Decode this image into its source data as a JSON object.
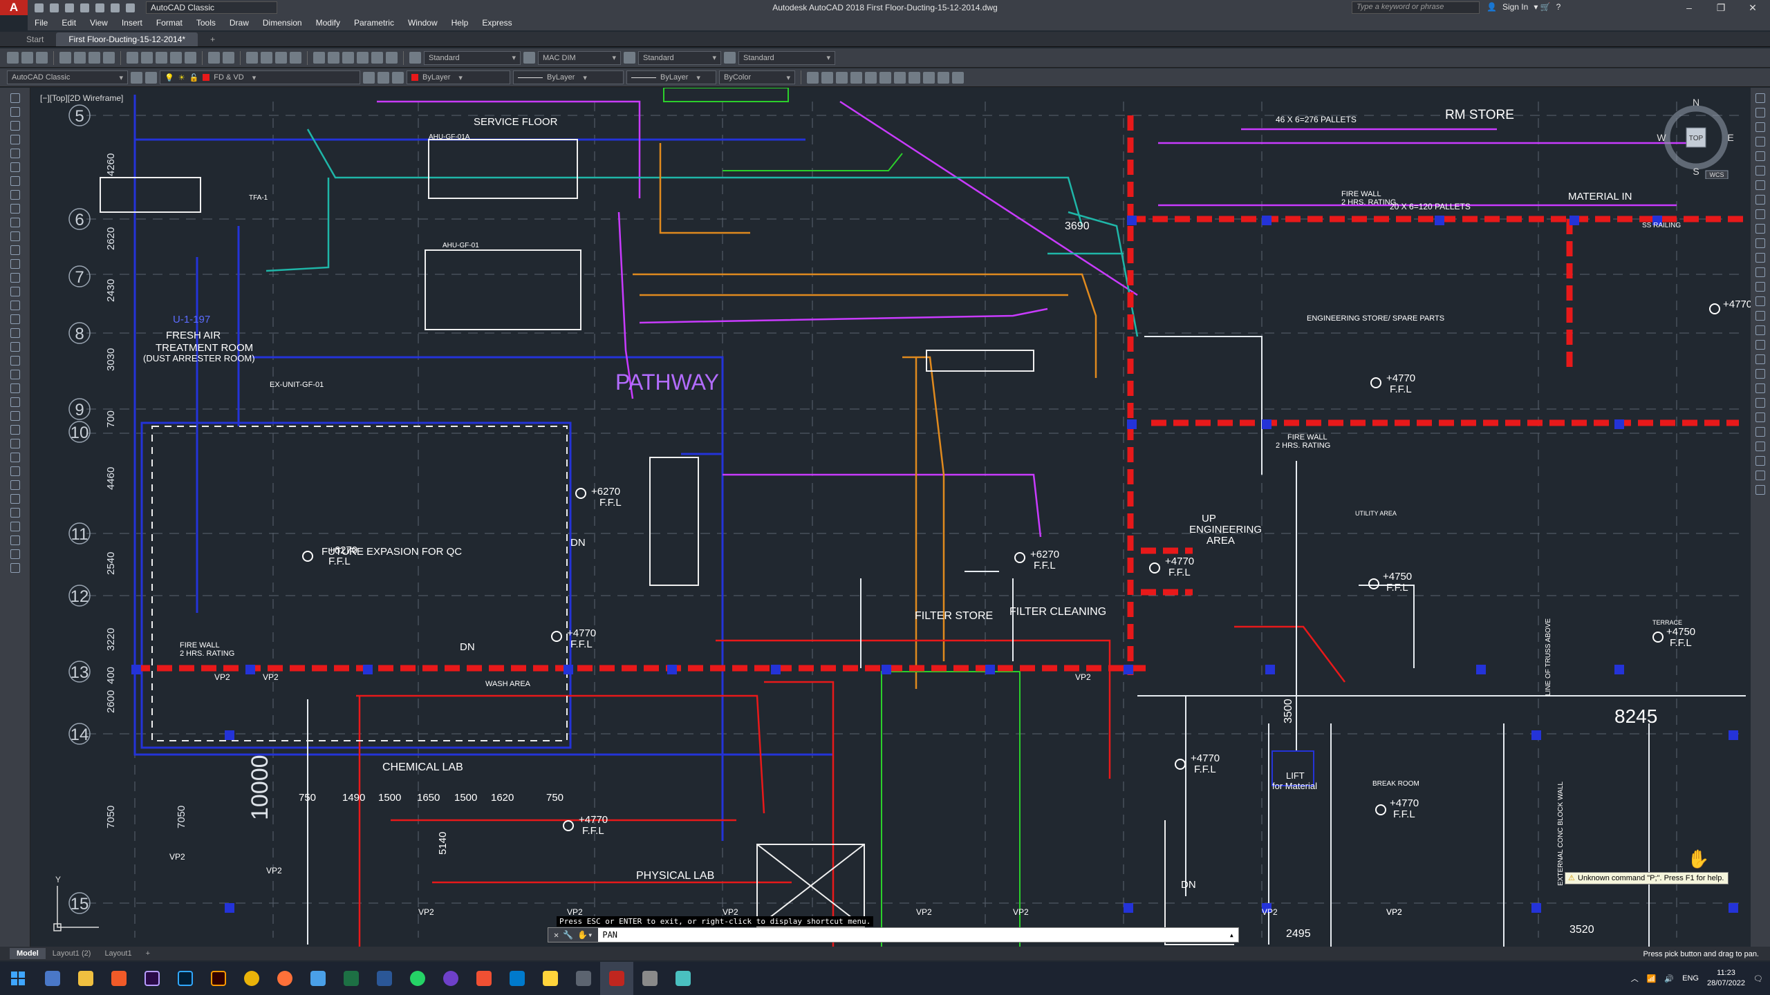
{
  "titlebar": {
    "logo": "A",
    "workspace": "AutoCAD Classic",
    "title": "Autodesk AutoCAD 2018    First Floor-Ducting-15-12-2014.dwg",
    "search_placeholder": "Type a keyword or phrase",
    "signin": "Sign In"
  },
  "menu": [
    "File",
    "Edit",
    "View",
    "Insert",
    "Format",
    "Tools",
    "Draw",
    "Dimension",
    "Modify",
    "Parametric",
    "Window",
    "Help",
    "Express"
  ],
  "tabs": [
    "Start",
    "First Floor-Ducting-15-12-2014*"
  ],
  "toolbar1": {
    "text_style": "Standard",
    "dim_style": "MAC DIM",
    "table_style": "Standard",
    "mleader_style": "Standard"
  },
  "toolbar2": {
    "workspace": "AutoCAD Classic",
    "layer": "FD & VD",
    "color": "ByLayer",
    "linetype": "ByLayer",
    "lineweight": "ByLayer",
    "plotstyle": "ByColor"
  },
  "viewport_label": "[−][Top][2D Wireframe]",
  "viewcube": {
    "n": "N",
    "s": "S",
    "e": "E",
    "w": "W",
    "top": "TOP",
    "wcs": "WCS"
  },
  "drawing": {
    "grid_labels": [
      "5",
      "6",
      "7",
      "8",
      "9",
      "10",
      "11",
      "12",
      "13",
      "14",
      "15"
    ],
    "dims_left": [
      "4260",
      "2620",
      "2430",
      "3030",
      "700",
      "4460",
      "2540",
      "3220",
      "400",
      "2600",
      "7050",
      "7050",
      "10000"
    ],
    "rooms": {
      "service_floor": "SERVICE FLOOR",
      "fresh_air": "FRESH AIR",
      "treatment_room": "TREATMENT ROOM",
      "dust": "(DUST ARRESTER ROOM)",
      "u197": "U-1-197",
      "pathway": "PATHWAY",
      "future": "FUTURE EXPASION FOR QC",
      "rm_store": "RM STORE",
      "pallets1": "46 X 6=276 PALLETS",
      "pallets2": "20 X 6=120 PALLETS",
      "material_in": "MATERIAL IN",
      "fire_wall": "FIRE WALL",
      "fire_rating": "2 HRS. RATING",
      "eng_store": "ENGINEERING STORE/ SPARE PARTS",
      "filter_store": "FILTER STORE",
      "filter_cleaning": "FILTER CLEANING",
      "up": "UP",
      "eng_area1": "ENGINEERING",
      "eng_area2": "AREA",
      "chemical_lab": "CHEMICAL LAB",
      "physical_lab": "PHYSICAL LAB",
      "wash_area": "WASH AREA",
      "lift1": "LIFT",
      "lift2": "for Material",
      "break_room": "BREAK ROOM",
      "utility": "UTILITY AREA",
      "terrace": "TERRACE",
      "dn": "DN",
      "ex_unit": "EX-UNIT-GF-01",
      "ahu1": "AHU-GF-01A",
      "ahu2": "AHU-GF-01",
      "tfa": "TFA-1",
      "line_truss": "LINE OF TRUSS ABOVE",
      "ext_wall": "EXTERNAL CONC BLOCK WALL",
      "ss_railing": "SS RAILING",
      "vp2": "VP2"
    },
    "levels": {
      "ffl": "F.F.L",
      "l6270": "+6270",
      "l4770": "+4770",
      "l4750": "+4750"
    },
    "dims_misc": [
      "3690",
      "8245",
      "3500",
      "2495",
      "3520",
      "750",
      "1490",
      "1500",
      "1650",
      "1500",
      "1620",
      "750",
      "5140"
    ]
  },
  "cmd": {
    "message": "Press ESC or ENTER to exit, or right-click to display shortcut menu.",
    "value": "PAN"
  },
  "tooltip": "Unknown command \"P;\".  Press F1 for help.",
  "layout_tabs": [
    "Model",
    "Layout1 (2)",
    "Layout1"
  ],
  "status": "Press pick button and drag to pan.",
  "taskbar": {
    "lang": "ENG",
    "time": "11:23",
    "date": "28/07/2022"
  },
  "colors": {
    "titlebar": "#3b3f47",
    "canvas": "#212830",
    "firewall": "#e8191a",
    "duct_blue": "#1f2fd6",
    "magenta": "#c93bff",
    "orange": "#e08a1e",
    "green": "#2bd02b",
    "accent": "#c0261f"
  }
}
